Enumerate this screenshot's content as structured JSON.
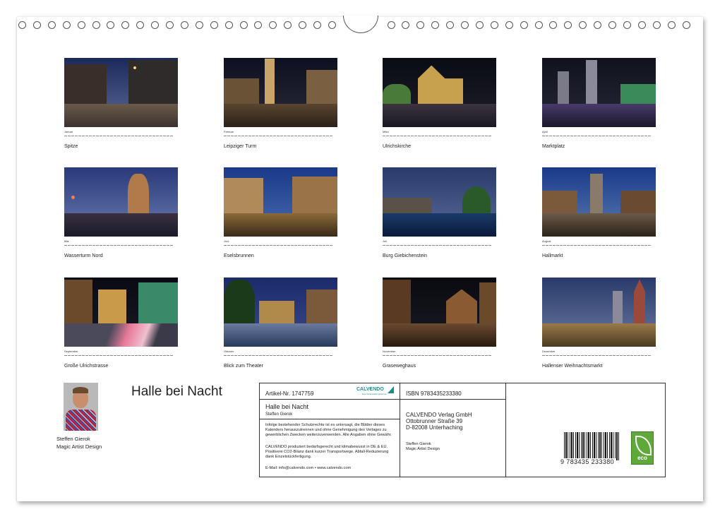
{
  "calendar_title": "Halle bei Nacht",
  "author": {
    "name": "Steffen Gierok",
    "label": "Magic Artist Design"
  },
  "months": [
    {
      "label": "Januar",
      "caption": "Spitze"
    },
    {
      "label": "Februar",
      "caption": "Leipziger Turm"
    },
    {
      "label": "März",
      "caption": "Ulrichskirche"
    },
    {
      "label": "April",
      "caption": "Marktplatz"
    },
    {
      "label": "Mai",
      "caption": "Wasserturm Nord"
    },
    {
      "label": "Juni",
      "caption": "Eselsbrunnen"
    },
    {
      "label": "Juli",
      "caption": "Burg Giebichenstein"
    },
    {
      "label": "August",
      "caption": "Hallmarkt"
    },
    {
      "label": "September",
      "caption": "Große Ulrichstrasse"
    },
    {
      "label": "Oktober",
      "caption": "Blick zum Theater"
    },
    {
      "label": "November",
      "caption": "Graseweghaus"
    },
    {
      "label": "Dezember",
      "caption": "Hallenser Weihnachtsmarkt"
    }
  ],
  "info": {
    "article": "Artikel-Nr. 1747759",
    "logo": "CALVENDO",
    "logo_sub": "Das Veranstaltungsformat",
    "title": "Halle bei Nacht",
    "author": "Steffen Gierok",
    "legal1": "Infolge bestehender Schutzrechte ist es untersagt, die Blätter dieses Kalenders herauszutrennen und ohne Genehmigung des Verlages zu gewerblichen Zwecken weiterzuverwenden. Alle Angaben ohne Gewähr.",
    "legal2": "CALVENDO produziert bedarfsgerecht und klimabewusst in DE & EU. Positivere CO2-Bilanz dank kurzer Transportwege. Abfall-Reduzierung dank Einzelstückfertigung.",
    "email": "E-Mail: info@calvendo.com • www.calvendo.com",
    "isbn": "ISBN 9783435233380",
    "publisher_line1": "CALVENDO Verlag GmbH",
    "publisher_line2": "Ottobrunner Straße 39",
    "publisher_line3": "D-82008 Unterhaching",
    "small_author1": "Steffen Gierok",
    "small_author2": "Magic Artist Design",
    "barcode_number": "9 783435 233380",
    "eco_label": "eco"
  },
  "colors": {
    "accent": "#1f8b8b",
    "eco_green": "#5fa83a"
  }
}
